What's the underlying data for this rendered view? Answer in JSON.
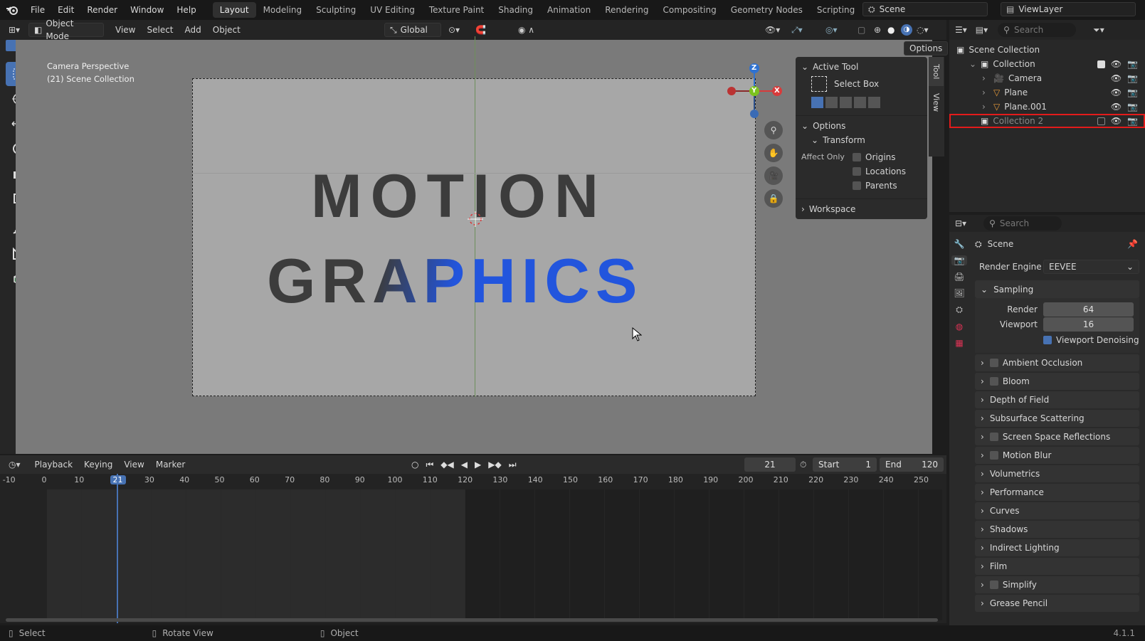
{
  "menus": [
    "File",
    "Edit",
    "Render",
    "Window",
    "Help"
  ],
  "workspaces": [
    {
      "label": "Layout",
      "active": true
    },
    {
      "label": "Modeling"
    },
    {
      "label": "Sculpting"
    },
    {
      "label": "UV Editing"
    },
    {
      "label": "Texture Paint"
    },
    {
      "label": "Shading"
    },
    {
      "label": "Animation"
    },
    {
      "label": "Rendering"
    },
    {
      "label": "Compositing"
    },
    {
      "label": "Geometry Nodes"
    },
    {
      "label": "Scripting"
    }
  ],
  "scene": {
    "label": "Scene",
    "viewlayer": "ViewLayer"
  },
  "viewport_header": {
    "mode": "Object Mode",
    "menus": [
      "View",
      "Select",
      "Add",
      "Object"
    ],
    "orientation": "Global",
    "options": "Options"
  },
  "viewport": {
    "info_line1": "Camera Perspective",
    "info_line2": "(21) Scene Collection",
    "text_line1": "MOTION",
    "text_line2": "GRAPHICS",
    "gizmo": {
      "z": "Z",
      "y": "Y",
      "x": "X"
    }
  },
  "npanel": {
    "tabs": [
      "Tool",
      "View"
    ],
    "active_tool_title": "Active Tool",
    "active_tool_name": "Select Box",
    "options_title": "Options",
    "transform_title": "Transform",
    "affect_only": "Affect Only",
    "affect": [
      {
        "label": "Origins"
      },
      {
        "label": "Locations"
      },
      {
        "label": "Parents"
      }
    ],
    "workspace_title": "Workspace"
  },
  "outliner": {
    "search_placeholder": "Search",
    "root": "Scene Collection",
    "rows": [
      {
        "label": "Collection",
        "indent": 1,
        "kind": "collection",
        "checked": true
      },
      {
        "label": "Camera",
        "indent": 2,
        "kind": "camera"
      },
      {
        "label": "Plane",
        "indent": 2,
        "kind": "mesh"
      },
      {
        "label": "Plane.001",
        "indent": 2,
        "kind": "mesh"
      },
      {
        "label": "Collection 2",
        "indent": 1,
        "kind": "collection",
        "checked": false,
        "highlighted": true
      }
    ]
  },
  "properties": {
    "search_placeholder": "Search",
    "context": "Scene",
    "render_engine_label": "Render Engine",
    "render_engine": "EEVEE",
    "sampling_title": "Sampling",
    "render_label": "Render",
    "render_value": "64",
    "viewport_label": "Viewport",
    "viewport_value": "16",
    "denoise_label": "Viewport Denoising",
    "sections": [
      {
        "label": "Ambient Occlusion",
        "checkbox": true
      },
      {
        "label": "Bloom",
        "checkbox": true
      },
      {
        "label": "Depth of Field",
        "checkbox": false
      },
      {
        "label": "Subsurface Scattering",
        "checkbox": false
      },
      {
        "label": "Screen Space Reflections",
        "checkbox": true
      },
      {
        "label": "Motion Blur",
        "checkbox": true
      },
      {
        "label": "Volumetrics",
        "checkbox": false
      },
      {
        "label": "Performance",
        "checkbox": false
      },
      {
        "label": "Curves",
        "checkbox": false
      },
      {
        "label": "Shadows",
        "checkbox": false
      },
      {
        "label": "Indirect Lighting",
        "checkbox": false
      },
      {
        "label": "Film",
        "checkbox": false
      },
      {
        "label": "Simplify",
        "checkbox": true
      },
      {
        "label": "Grease Pencil",
        "checkbox": false
      }
    ]
  },
  "timeline": {
    "menus": [
      "Playback",
      "Keying",
      "View",
      "Marker"
    ],
    "current_frame": "21",
    "start_label": "Start",
    "start": "1",
    "end_label": "End",
    "end": "120",
    "ticks": [
      "-10",
      "0",
      "10",
      "21",
      "30",
      "40",
      "50",
      "60",
      "70",
      "80",
      "90",
      "100",
      "110",
      "120",
      "130",
      "140",
      "150",
      "160",
      "170",
      "180",
      "190",
      "200",
      "210",
      "220",
      "230",
      "240",
      "250"
    ]
  },
  "status": {
    "select": "Select",
    "rotate": "Rotate View",
    "object": "Object",
    "version": "4.1.1"
  },
  "colors": {
    "accent": "#4772b3",
    "highlight": "#e31b1b",
    "blue_text": "#2255dd",
    "dark_text": "#3c3c3c"
  }
}
